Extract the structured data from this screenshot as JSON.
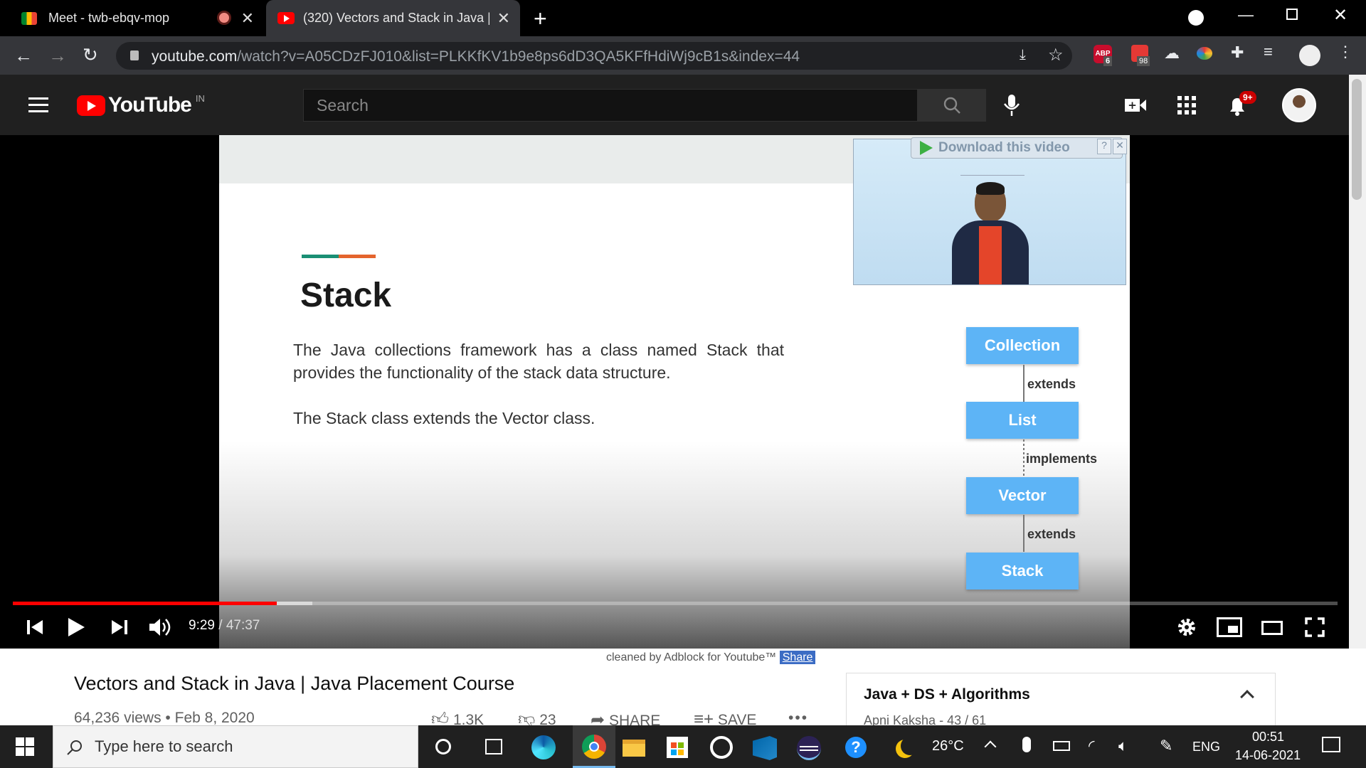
{
  "browser": {
    "tabs": [
      {
        "title": "Meet - twb-ebqv-mop",
        "active": false
      },
      {
        "title": "(320) Vectors and Stack in Java | J",
        "active": true
      }
    ],
    "new_tab": "+",
    "url_host": "youtube.com",
    "url_rest": "/watch?v=A05CDzFJ010&list=PLKKfKV1b9e8ps6dD3QA5KFfHdiWj9cB1s&index=44",
    "ext_badge_abp": "6",
    "ext_badge_2": "98",
    "ext_abp_label": "ABP"
  },
  "youtube": {
    "logo_text": "YouTube",
    "region": "IN",
    "search_placeholder": "Search",
    "notification_count": "9+"
  },
  "slide": {
    "heading": "Stack",
    "para1": "The Java collections framework has a class named Stack that provides the functionality of the stack data structure.",
    "para2": "The Stack class extends the Vector class.",
    "uml": {
      "boxes": [
        "Collection",
        "List",
        "Vector",
        "Stack"
      ],
      "relations": [
        "extends",
        "implements",
        "extends"
      ]
    },
    "download_label": "Download this video",
    "download_help": "?"
  },
  "player": {
    "time_current": "9:29",
    "time_sep": " / ",
    "time_total": "47:37",
    "played_fraction": 0.199,
    "buffered_fraction": 0.226,
    "colors": {
      "played": "#ff0000",
      "accent": "#3ea6ff"
    }
  },
  "below_player": {
    "adblock_note": "cleaned by Adblock for Youtube™",
    "share_label": "Share",
    "video_title": "Vectors and Stack in Java | Java Placement Course",
    "views": "64,236 views",
    "dot": "•",
    "date": "Feb 8, 2020",
    "likes": "1.3K",
    "dislikes": "23",
    "share": "SHARE",
    "save": "SAVE",
    "more": "•••",
    "playlist_title": "Java + DS + Algorithms",
    "playlist_channel": "Apni Kaksha",
    "playlist_position": "- 43 / 61"
  },
  "taskbar": {
    "search_placeholder": "Type here to search",
    "temperature": "26°C",
    "language": "ENG",
    "time": "00:51",
    "date": "14-06-2021",
    "help_glyph": "?"
  }
}
